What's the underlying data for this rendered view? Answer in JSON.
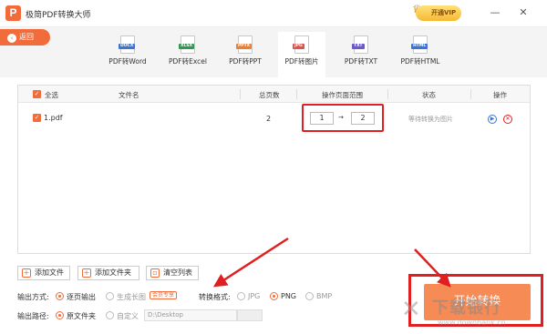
{
  "app": {
    "title": "极简PDF转换大师",
    "vip_label": "开通VIP"
  },
  "toolbar": {
    "back_label": "返回",
    "tabs": [
      {
        "label": "PDF转Word",
        "tag": "DOCX",
        "tag_color": "#3b74d6"
      },
      {
        "label": "PDF转Excel",
        "tag": "XLSX",
        "tag_color": "#2e9a4d"
      },
      {
        "label": "PDF转PPT",
        "tag": "PPTX",
        "tag_color": "#e8803a"
      },
      {
        "label": "PDF转图片",
        "tag": "JPG",
        "tag_color": "#d9534f"
      },
      {
        "label": "PDF转TXT",
        "tag": "TXT",
        "tag_color": "#6a5acd"
      },
      {
        "label": "PDF转HTML",
        "tag": "HTML",
        "tag_color": "#3b74d6"
      }
    ],
    "active_tab": 3
  },
  "table": {
    "headers": {
      "select_all": "全选",
      "filename": "文件名",
      "pages": "总页数",
      "range": "操作页面范围",
      "status": "状态",
      "action": "操作"
    },
    "rows": [
      {
        "filename": "1.pdf",
        "pages": "2",
        "range_from": "1",
        "range_sep": "→",
        "range_to": "2",
        "status": "等待转换为图片"
      }
    ]
  },
  "bottom": {
    "add_file": "添加文件",
    "add_folder": "添加文件夹",
    "clear_list": "清空列表",
    "output_mode_label": "输出方式:",
    "output_mode_options": [
      "逐页输出",
      "生成长图"
    ],
    "member_badge": "会员专享",
    "format_label": "转换格式:",
    "format_options": [
      "JPG",
      "PNG",
      "BMP"
    ],
    "output_path_label": "输出路径:",
    "path_options": [
      "原文件夹",
      "自定义"
    ],
    "path_value": "D:\\Desktop",
    "start_label": "开始转换"
  },
  "watermark": {
    "big": "下载银行",
    "small": "www.downbank.cn"
  },
  "colors": {
    "accent": "#f26b3a",
    "highlight": "#e02020"
  }
}
